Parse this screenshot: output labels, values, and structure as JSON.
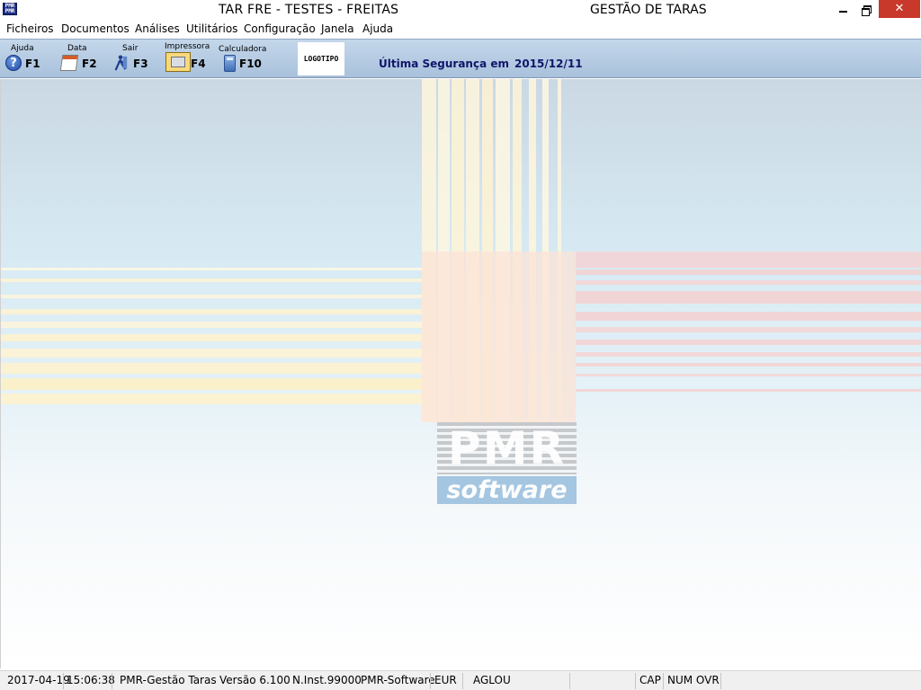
{
  "window": {
    "app_name": "TAR FRE - TESTES - FREITAS",
    "module_title": "GESTÃO DE TARAS",
    "app_icon_text": "PMR",
    "close_glyph": "✕"
  },
  "menu": [
    "Ficheiros",
    "Documentos",
    "Análises",
    "Utilitários",
    "Configuração",
    "Janela",
    "Ajuda"
  ],
  "toolbar": {
    "tools": [
      {
        "label": "Ajuda",
        "key": "F1",
        "icon": "help-icon"
      },
      {
        "label": "Data",
        "key": "F2",
        "icon": "calendar-icon"
      },
      {
        "label": "Sair",
        "key": "F3",
        "icon": "exit-person-icon"
      },
      {
        "label": "Impressora",
        "key": "F4",
        "icon": "printer-icon"
      },
      {
        "label": "Calculadora",
        "key": "F10",
        "icon": "calculator-icon"
      }
    ],
    "help_glyph": "?",
    "logo_text": "LOGOTIPO",
    "security_label": "Última Segurança em",
    "security_date": "2015/12/11"
  },
  "watermark": {
    "brand": "PMR",
    "tagline": "software"
  },
  "statusbar": {
    "date": "2017-04-19",
    "time": "15:06:38",
    "product": "PMR-Gestão Taras",
    "version": "Versão  6.100",
    "installation": "N.Inst.99000",
    "vendor": "PMR-Software",
    "currency": "EUR",
    "user": "AGLOU",
    "cap": "CAP",
    "num_ovr": "NUM OVR"
  },
  "colors": {
    "close_button": "#c8392b",
    "toolbar_text_accent": "#10166a",
    "toolbar_background": "#b7cce3"
  }
}
